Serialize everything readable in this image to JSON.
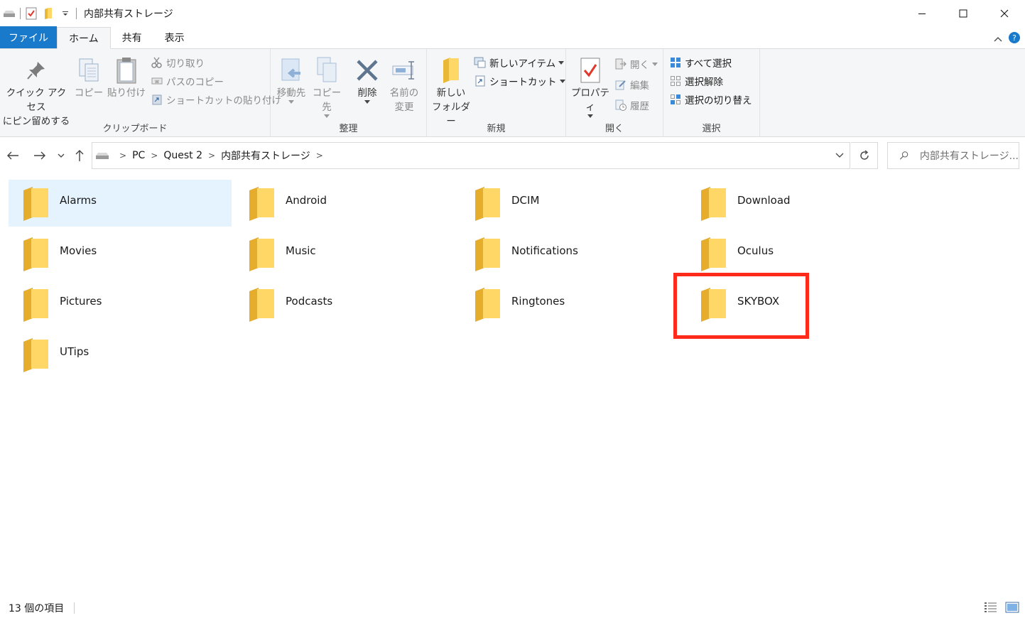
{
  "window": {
    "title": "内部共有ストレージ",
    "minimize": "—",
    "maximize": "☐",
    "close": "✕"
  },
  "tabs": [
    {
      "label": "ファイル"
    },
    {
      "label": "ホーム"
    },
    {
      "label": "共有"
    },
    {
      "label": "表示"
    }
  ],
  "ribbon": {
    "clipboard": {
      "label": "クリップボード",
      "pin": [
        "クイック アクセス",
        "にピン留めする"
      ],
      "copy": "コピー",
      "paste": "貼り付け",
      "cut": "切り取り",
      "copy_path": "パスのコピー",
      "paste_shortcut": "ショートカットの貼り付け"
    },
    "organize": {
      "label": "整理",
      "move_to": "移動先",
      "copy_to": "コピー先",
      "delete": "削除",
      "rename": [
        "名前の",
        "変更"
      ]
    },
    "new": {
      "label": "新規",
      "new_folder": [
        "新しい",
        "フォルダー"
      ],
      "new_item": "新しいアイテム",
      "shortcut": "ショートカット"
    },
    "open": {
      "label": "開く",
      "properties": "プロパティ",
      "open": "開く",
      "edit": "編集",
      "history": "履歴"
    },
    "select": {
      "label": "選択",
      "select_all": "すべて選択",
      "select_none": "選択解除",
      "invert": "選択の切り替え"
    }
  },
  "address": {
    "crumbs": [
      "PC",
      "Quest 2",
      "内部共有ストレージ"
    ],
    "search_placeholder": "内部共有ストレージ..."
  },
  "folders": [
    {
      "name": "Alarms",
      "selected": true
    },
    {
      "name": "Android"
    },
    {
      "name": "DCIM"
    },
    {
      "name": "Download"
    },
    {
      "name": "Movies"
    },
    {
      "name": "Music"
    },
    {
      "name": "Notifications"
    },
    {
      "name": "Oculus"
    },
    {
      "name": "Pictures"
    },
    {
      "name": "Podcasts"
    },
    {
      "name": "Ringtones"
    },
    {
      "name": "SKYBOX",
      "highlighted": true
    },
    {
      "name": "UTips"
    }
  ],
  "status": {
    "count": "13 個の項目"
  },
  "colors": {
    "accent": "#1979ca",
    "selection": "#e5f3ff",
    "highlight_box": "#ff2a1a",
    "folder": "#ffd766"
  }
}
